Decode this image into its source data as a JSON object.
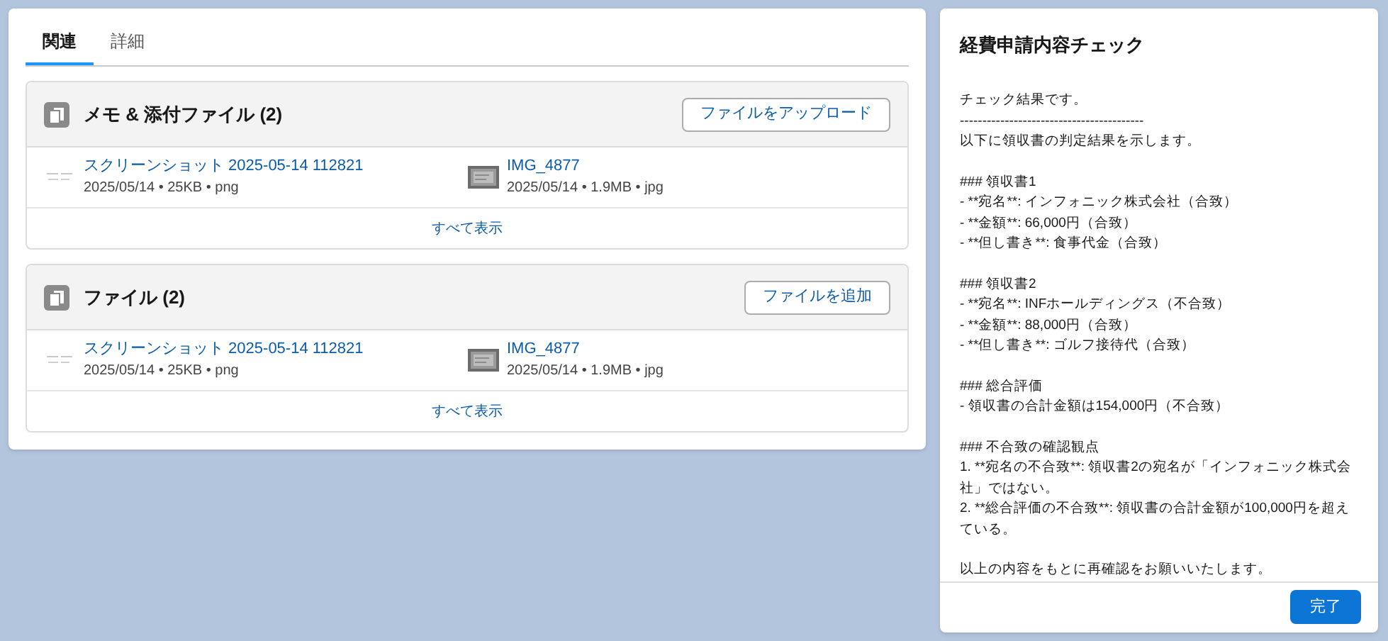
{
  "tabs": [
    {
      "label": "関連",
      "selected": true
    },
    {
      "label": "詳細",
      "selected": false
    }
  ],
  "cards": [
    {
      "title": "メモ & 添付ファイル (2)",
      "button": "ファイルをアップロード",
      "files": [
        {
          "name": "スクリーンショット 2025-05-14 112821",
          "meta": "2025/05/14 • 25KB • png",
          "kind": "picture"
        },
        {
          "name": "IMG_4877",
          "meta": "2025/05/14 • 1.9MB • jpg",
          "kind": "picture"
        }
      ],
      "view_all": "すべて表示"
    },
    {
      "title": "ファイル (2)",
      "button": "ファイルを追加",
      "files": [
        {
          "name": "スクリーンショット 2025-05-14 112821",
          "meta": "2025/05/14 • 25KB • png",
          "kind": "picture"
        },
        {
          "name": "IMG_4877",
          "meta": "2025/05/14 • 1.9MB • jpg",
          "kind": "picture"
        }
      ],
      "view_all": "すべて表示"
    }
  ],
  "dialog": {
    "title": "経費申請内容チェック",
    "paragraphs": [
      [
        "チェック結果です。",
        "-----------------------------------------",
        "以下に領収書の判定結果を示します。"
      ],
      [
        "### 領収書1",
        "- **宛名**: インフォニック株式会社（合致）",
        "- **金額**: 66,000円（合致）",
        "- **但し書き**: 食事代金（合致）"
      ],
      [
        "### 領収書2",
        "- **宛名**: INFホールディングス（不合致）",
        "- **金額**: 88,000円（合致）",
        "- **但し書き**: ゴルフ接待代（合致）"
      ],
      [
        "### 総合評価",
        "- 領収書の合計金額は154,000円（不合致）"
      ],
      [
        "### 不合致の確認観点",
        "1. **宛名の不合致**: 領収書2の宛名が「インフォニック株式会社」ではない。",
        "2. **総合評価の不合致**: 領収書の合計金額が100,000円を超えている。"
      ],
      [
        "以上の内容をもとに再確認をお願いいたします。"
      ]
    ],
    "button": "完了"
  }
}
